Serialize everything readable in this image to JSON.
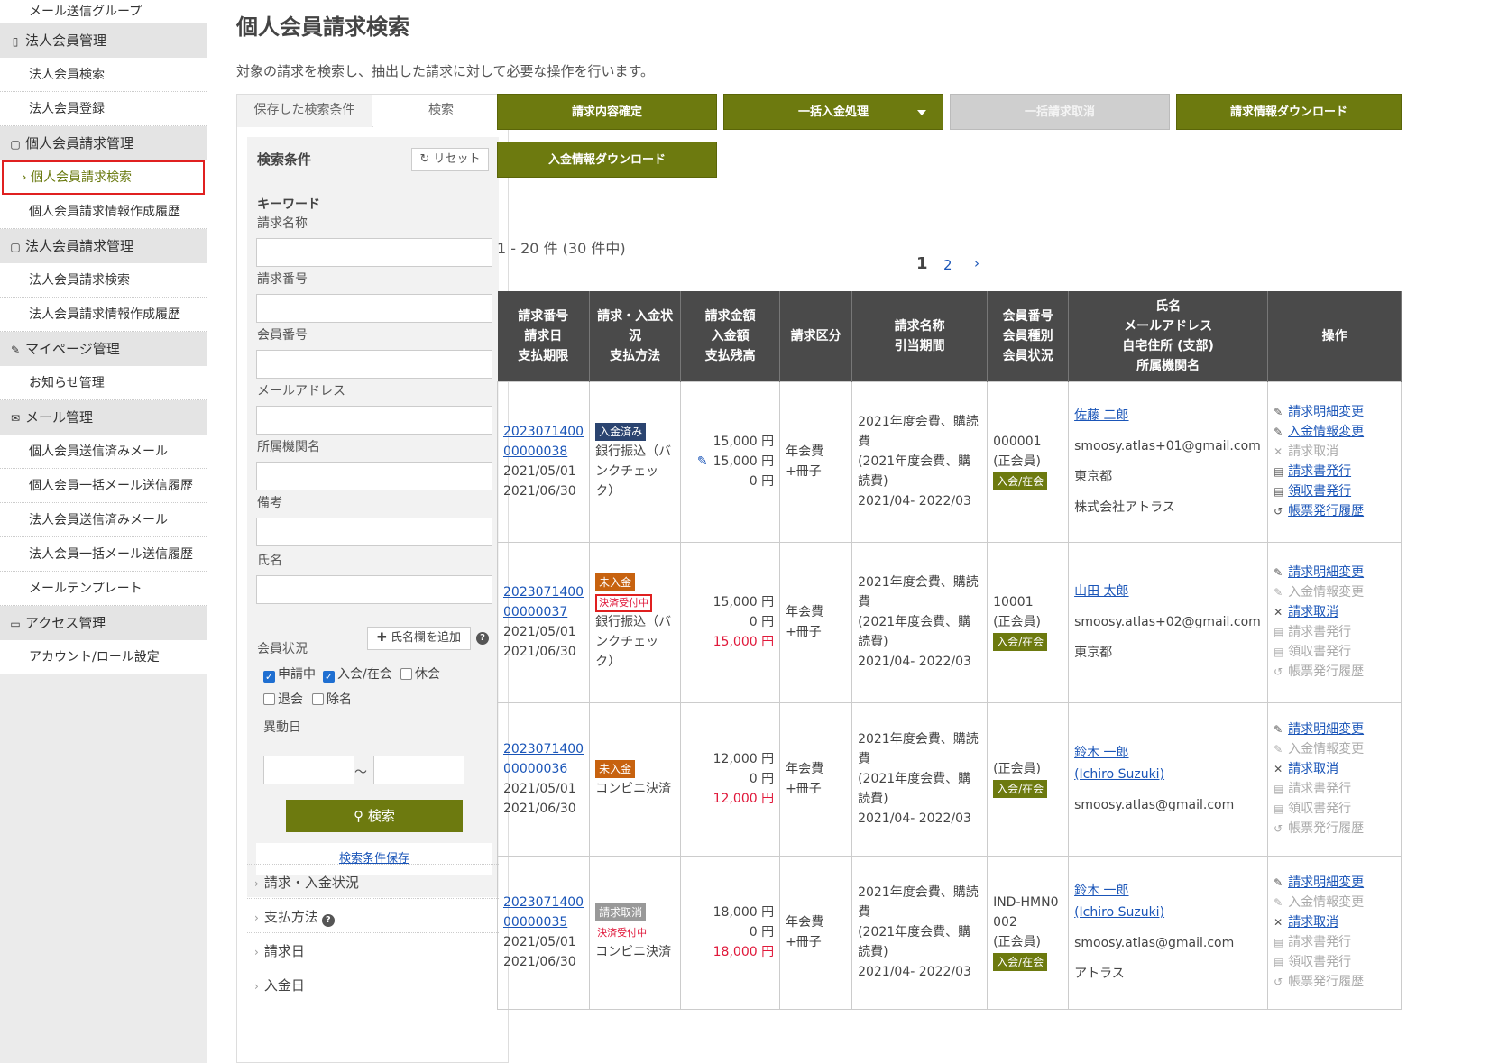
{
  "sidebar": {
    "items": [
      {
        "type": "item",
        "label": "メール送信グループ"
      },
      {
        "type": "head",
        "icon": "▯",
        "label": "法人会員管理"
      },
      {
        "type": "item",
        "label": "法人会員検索"
      },
      {
        "type": "item",
        "label": "法人会員登録"
      },
      {
        "type": "head",
        "icon": "▢",
        "label": "個人会員請求管理"
      },
      {
        "type": "active",
        "label": "› 個人会員請求検索"
      },
      {
        "type": "item",
        "label": "個人会員請求情報作成履歴"
      },
      {
        "type": "head",
        "icon": "▢",
        "label": "法人会員請求管理"
      },
      {
        "type": "item",
        "label": "法人会員請求検索"
      },
      {
        "type": "item",
        "label": "法人会員請求情報作成履歴"
      },
      {
        "type": "head",
        "icon": "✎",
        "label": "マイページ管理"
      },
      {
        "type": "item",
        "label": "お知らせ管理"
      },
      {
        "type": "head",
        "icon": "✉",
        "label": "メール管理"
      },
      {
        "type": "item",
        "label": "個人会員送信済みメール"
      },
      {
        "type": "item",
        "label": "個人会員一括メール送信履歴"
      },
      {
        "type": "item",
        "label": "法人会員送信済みメール"
      },
      {
        "type": "item",
        "label": "法人会員一括メール送信履歴"
      },
      {
        "type": "item",
        "label": "メールテンプレート"
      },
      {
        "type": "head",
        "icon": "▭",
        "label": "アクセス管理"
      },
      {
        "type": "item",
        "label": "アカウント/ロール設定"
      }
    ]
  },
  "page": {
    "title": "個人会員請求検索",
    "description": "対象の請求を検索し、抽出した請求に対して必要な操作を行います。"
  },
  "search": {
    "tab_saved": "保存した検索条件",
    "tab_search": "検索",
    "title": "検索条件",
    "reset": "リセット",
    "keyword": "キーワード",
    "fields": [
      "請求名称",
      "請求番号",
      "会員番号",
      "メールアドレス",
      "所属機関名",
      "備考",
      "氏名"
    ],
    "add_name": "氏名欄を追加",
    "help": "?",
    "member_status": "会員状況",
    "status_options": [
      {
        "label": "申請中",
        "checked": true
      },
      {
        "label": "入会/在会",
        "checked": true
      },
      {
        "label": "休会",
        "checked": false
      },
      {
        "label": "退会",
        "checked": false
      },
      {
        "label": "除名",
        "checked": false
      }
    ],
    "change_date": "異動日",
    "tilde": "～",
    "search_button": "検索",
    "save_link": "検索条件保存",
    "accordions": [
      "請求・入金状況",
      "支払方法",
      "請求日",
      "入金日"
    ]
  },
  "actions": {
    "confirm": "請求内容確定",
    "bulk_payment": "一括入金処理",
    "bulk_cancel": "一括請求取消",
    "download_invoice": "請求情報ダウンロード",
    "download_payment": "入金情報ダウンロード"
  },
  "result": {
    "count": "1 - 20 件 (30 件中)",
    "pages": [
      "1",
      "2"
    ],
    "next": "›"
  },
  "table": {
    "headers": [
      [
        "請求番号",
        "請求日",
        "支払期限"
      ],
      [
        "請求・入金状",
        "況",
        "支払方法"
      ],
      [
        "請求金額",
        "入金額",
        "支払残高"
      ],
      [
        "請求区分"
      ],
      [
        "請求名称",
        "引当期間"
      ],
      [
        "会員番号",
        "会員種別",
        "会員状況"
      ],
      [
        "氏名",
        "メールアドレス",
        "自宅住所 (支部)",
        "所属機関名"
      ],
      [
        "操作"
      ]
    ],
    "rows": [
      {
        "num1": "2023071400",
        "num2": "00000038",
        "date": "2021/05/01",
        "due": "2021/06/30",
        "status": "入金済み",
        "status_color": "blue",
        "pending": "",
        "method": "銀行振込（バンクチェック）",
        "billed": "15,000 円",
        "paid": "15,000 円",
        "balance": "0 円",
        "balance_red": false,
        "paid_edit": true,
        "category": "年会費+冊子",
        "name_title": "2021年度会費、購読費",
        "name_sub": "(2021年度会費、購読費)",
        "period": "2021/04- 2022/03",
        "member_no": "000001",
        "member_type": "(正会員)",
        "member_status": "入会/在会",
        "person": "佐藤 二郎",
        "person_en": "",
        "email": "smoosy.atlas+01@gmail.com",
        "address": "東京都",
        "org": "株式会社アトラス",
        "ops": [
          {
            "icon": "✎",
            "label": "請求明細変更",
            "on": true
          },
          {
            "icon": "✎",
            "label": "入金情報変更",
            "on": true
          },
          {
            "icon": "✕",
            "label": "請求取消",
            "on": false
          },
          {
            "icon": "▤",
            "label": "請求書発行",
            "on": true
          },
          {
            "icon": "▤",
            "label": "領収書発行",
            "on": true
          },
          {
            "icon": "↺",
            "label": "帳票発行履歴",
            "on": true
          }
        ]
      },
      {
        "num1": "2023071400",
        "num2": "00000037",
        "date": "2021/05/01",
        "due": "2021/06/30",
        "status": "未入金",
        "status_color": "orange",
        "pending": "決済受付中",
        "pending_box": true,
        "method": "銀行振込（バンクチェック）",
        "billed": "15,000 円",
        "paid": "0 円",
        "balance": "15,000 円",
        "balance_red": true,
        "paid_edit": false,
        "category": "年会費+冊子",
        "name_title": "2021年度会費、購読費",
        "name_sub": "(2021年度会費、購読費)",
        "period": "2021/04- 2022/03",
        "member_no": "10001",
        "member_type": "(正会員)",
        "member_status": "入会/在会",
        "person": "山田 太郎",
        "person_en": "",
        "email": "smoosy.atlas+02@gmail.com",
        "address": "東京都",
        "org": "",
        "ops": [
          {
            "icon": "✎",
            "label": "請求明細変更",
            "on": true
          },
          {
            "icon": "✎",
            "label": "入金情報変更",
            "on": false
          },
          {
            "icon": "✕",
            "label": "請求取消",
            "on": true
          },
          {
            "icon": "▤",
            "label": "請求書発行",
            "on": false
          },
          {
            "icon": "▤",
            "label": "領収書発行",
            "on": false
          },
          {
            "icon": "↺",
            "label": "帳票発行履歴",
            "on": false
          }
        ]
      },
      {
        "num1": "2023071400",
        "num2": "00000036",
        "date": "2021/05/01",
        "due": "2021/06/30",
        "status": "未入金",
        "status_color": "orange",
        "pending": "",
        "method": "コンビニ決済",
        "billed": "12,000 円",
        "paid": "0 円",
        "balance": "12,000 円",
        "balance_red": true,
        "paid_edit": false,
        "category": "年会費+冊子",
        "name_title": "2021年度会費、購読費",
        "name_sub": "(2021年度会費、購読費)",
        "period": "2021/04- 2022/03",
        "member_no": "",
        "member_type": "(正会員)",
        "member_status": "入会/在会",
        "person": "鈴木 一郎",
        "person_en": "(Ichiro Suzuki)",
        "email": "smoosy.atlas@gmail.com",
        "address": "",
        "org": "",
        "ops": [
          {
            "icon": "✎",
            "label": "請求明細変更",
            "on": true
          },
          {
            "icon": "✎",
            "label": "入金情報変更",
            "on": false
          },
          {
            "icon": "✕",
            "label": "請求取消",
            "on": true
          },
          {
            "icon": "▤",
            "label": "請求書発行",
            "on": false
          },
          {
            "icon": "▤",
            "label": "領収書発行",
            "on": false
          },
          {
            "icon": "↺",
            "label": "帳票発行履歴",
            "on": false
          }
        ]
      },
      {
        "num1": "2023071400",
        "num2": "00000035",
        "date": "2021/05/01",
        "due": "2021/06/30",
        "status": "請求取消",
        "status_color": "gray",
        "pending": "決済受付中",
        "pending_box": false,
        "method": "コンビニ決済",
        "billed": "18,000 円",
        "paid": "0 円",
        "balance": "18,000 円",
        "balance_red": true,
        "paid_edit": false,
        "category": "年会費+冊子",
        "name_title": "2021年度会費、購読費",
        "name_sub": "(2021年度会費、購読費)",
        "period": "2021/04- 2022/03",
        "member_no": "IND-HMN0002",
        "member_type": "(正会員)",
        "member_status": "入会/在会",
        "person": "鈴木 一郎",
        "person_en": "(Ichiro Suzuki)",
        "email": "smoosy.atlas@gmail.com",
        "address": "",
        "org": "アトラス",
        "ops": [
          {
            "icon": "✎",
            "label": "請求明細変更",
            "on": true
          },
          {
            "icon": "✎",
            "label": "入金情報変更",
            "on": false
          },
          {
            "icon": "✕",
            "label": "請求取消",
            "on": true
          },
          {
            "icon": "▤",
            "label": "請求書発行",
            "on": false
          },
          {
            "icon": "▤",
            "label": "領収書発行",
            "on": false
          },
          {
            "icon": "↺",
            "label": "帳票発行履歴",
            "on": false
          }
        ]
      }
    ]
  }
}
